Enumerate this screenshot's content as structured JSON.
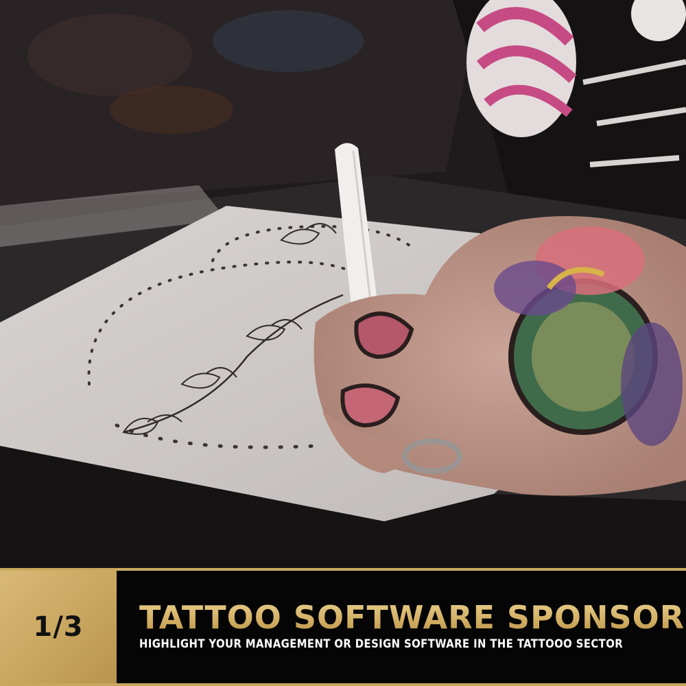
{
  "photo": {
    "alt": "Tattooed hand drawing a tattoo design on a tablet with a stylus"
  },
  "banner": {
    "counter": "1/3",
    "title": "TATTOO SOFTWARE SPONSOR",
    "subtitle": "HIGHLIGHT YOUR MANAGEMENT OR DESIGN SOFTWARE IN THE TATTOOO SECTOR"
  },
  "colors": {
    "gold": "#c9a85d",
    "banner_bg": "#050505",
    "title_gold": "#d6b56e",
    "subtitle": "#ffffff"
  }
}
